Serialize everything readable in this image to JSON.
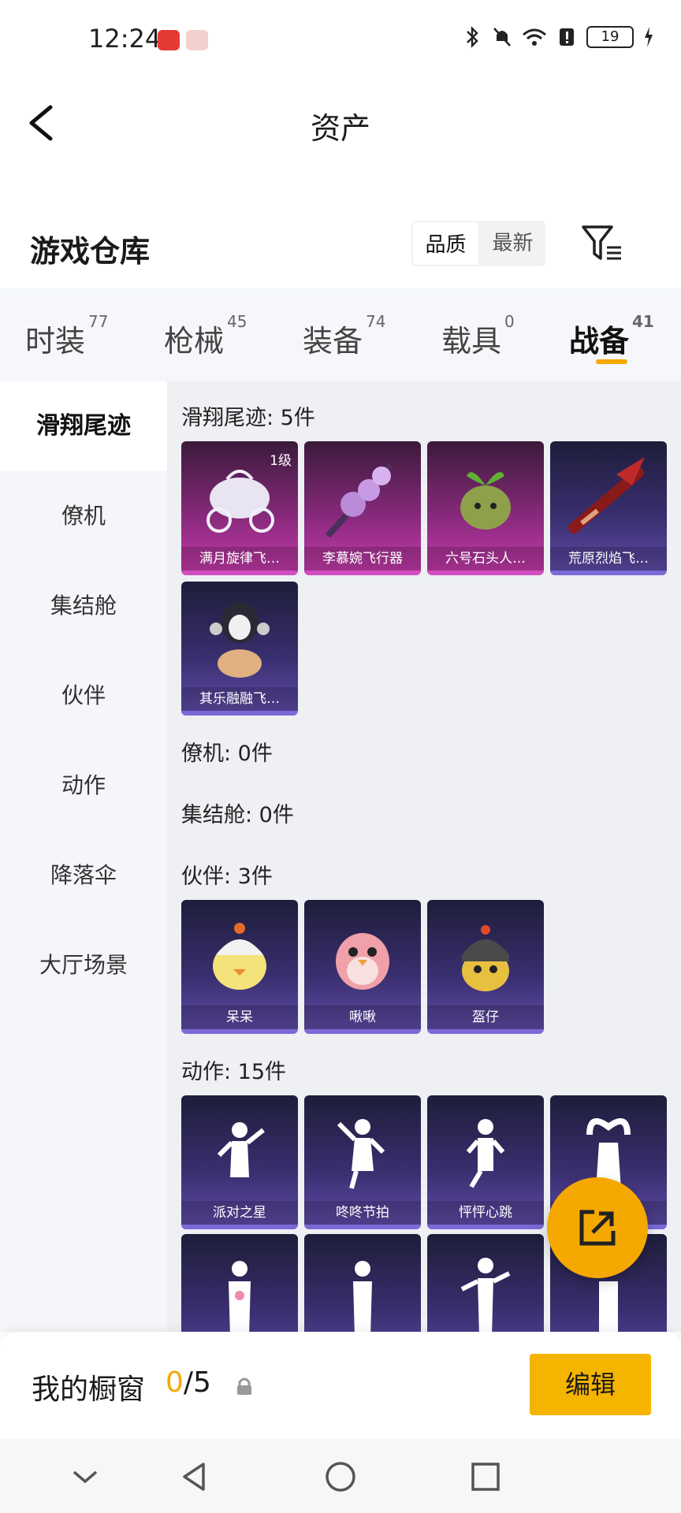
{
  "status_bar": {
    "time": "12:24",
    "battery": "19"
  },
  "header": {
    "title": "资产"
  },
  "warehouse": {
    "title": "游戏仓库",
    "sort_options": [
      "品质",
      "最新"
    ],
    "sort_active": "品质"
  },
  "tabs": [
    {
      "label": "时装",
      "count": "77"
    },
    {
      "label": "枪械",
      "count": "45"
    },
    {
      "label": "装备",
      "count": "74"
    },
    {
      "label": "载具",
      "count": "0"
    },
    {
      "label": "战备",
      "count": "41",
      "active": true
    }
  ],
  "sidebar": {
    "items": [
      "滑翔尾迹",
      "僚机",
      "集结舱",
      "伙伴",
      "动作",
      "降落伞",
      "大厅场景"
    ],
    "active": "滑翔尾迹"
  },
  "sections": {
    "glide_trail": {
      "title": "滑翔尾迹: 5件",
      "items": [
        {
          "name": "满月旋律飞…",
          "level": "1级",
          "rarity": "purple"
        },
        {
          "name": "李慕婉飞行器",
          "rarity": "purple"
        },
        {
          "name": "六号石头人…",
          "rarity": "purple"
        },
        {
          "name": "荒原烈焰飞…",
          "rarity": "blue"
        },
        {
          "name": "其乐融融飞…",
          "rarity": "blue"
        }
      ]
    },
    "wingman": {
      "title": "僚机: 0件"
    },
    "assembly_pod": {
      "title": "集结舱: 0件"
    },
    "partner": {
      "title": "伙伴: 3件",
      "items": [
        {
          "name": "呆呆",
          "rarity": "blue"
        },
        {
          "name": "啾啾",
          "rarity": "blue"
        },
        {
          "name": "盔仔",
          "rarity": "blue"
        }
      ]
    },
    "emote": {
      "title": "动作: 15件",
      "items": [
        {
          "name": "派对之星",
          "rarity": "blue"
        },
        {
          "name": "咚咚节拍",
          "rarity": "blue"
        },
        {
          "name": "怦怦心跳",
          "rarity": "blue"
        },
        {
          "name": "",
          "rarity": "blue"
        }
      ]
    }
  },
  "showcase": {
    "label": "我的橱窗",
    "current": "0",
    "total": "/5",
    "edit_label": "编辑"
  },
  "colors": {
    "accent": "#f5a800",
    "purple_card": "#c23aa8",
    "blue_card": "#5f4ba8"
  }
}
